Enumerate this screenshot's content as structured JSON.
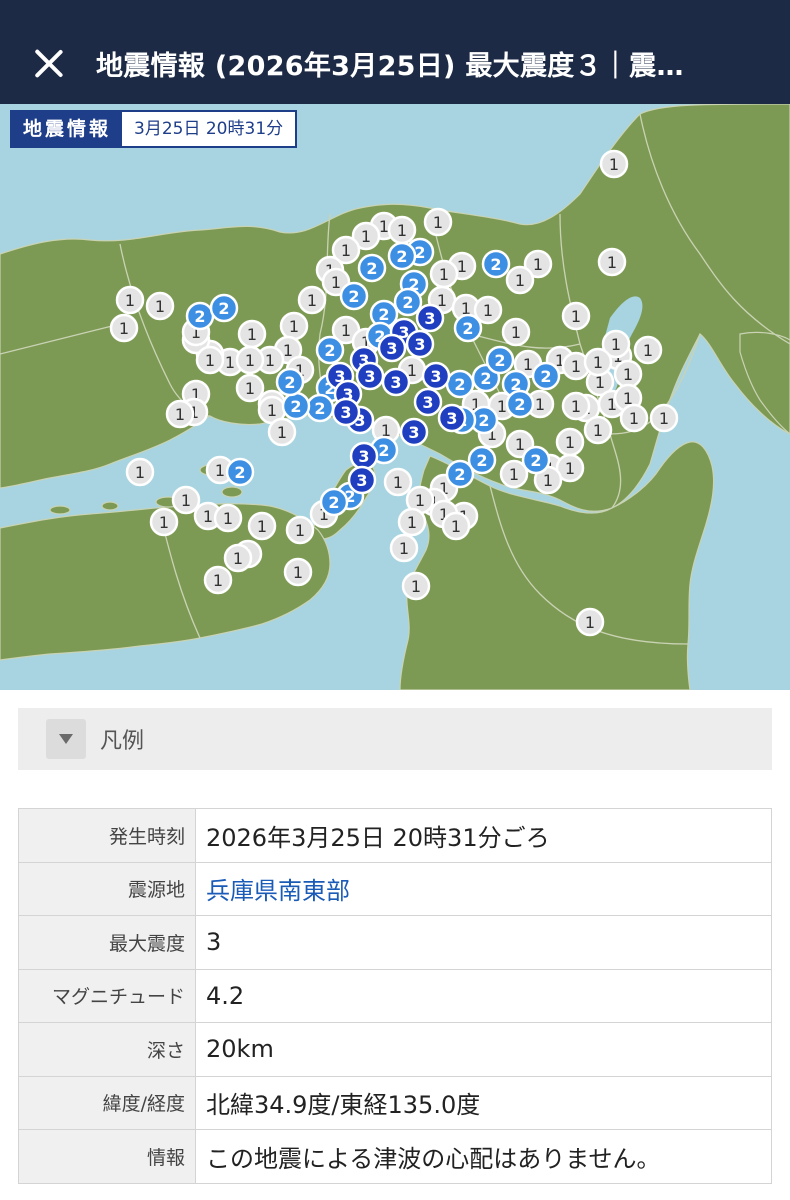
{
  "header": {
    "title": "地震情報 (2026年3月25日) 最大震度３｜震…"
  },
  "map": {
    "badge_label": "地震情報",
    "badge_time": "3月25日 20時31分",
    "colors": {
      "sea": "#a7d4e0",
      "land": "#7d9a54",
      "border": "#c9d3b4",
      "int1_fill": "#e4e4e4",
      "int1_text": "#333333",
      "int2_fill": "#3d8fe4",
      "int3_fill": "#1f3fc0"
    }
  },
  "legend": {
    "label": "凡例",
    "icon": "chevron-down-icon"
  },
  "info_table": [
    {
      "key": "発生時刻",
      "value": "2026年3月25日 20時31分ごろ"
    },
    {
      "key": "震源地",
      "value": "兵庫県南東部",
      "link": true
    },
    {
      "key": "最大震度",
      "value": "3"
    },
    {
      "key": "マグニチュード",
      "value": "4.2"
    },
    {
      "key": "深さ",
      "value": "20km"
    },
    {
      "key": "緯度/経度",
      "value": "北緯34.9度/東経135.0度"
    },
    {
      "key": "情報",
      "value": "この地震による津波の心配はありません。"
    }
  ]
}
